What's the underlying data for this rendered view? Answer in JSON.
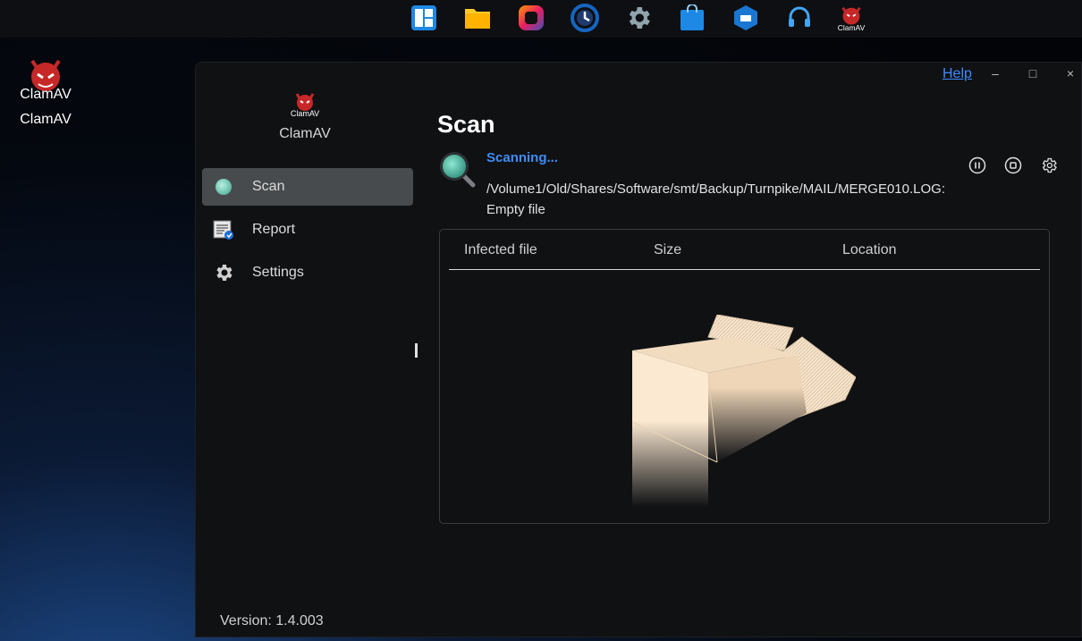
{
  "taskbar": {
    "apps": [
      {
        "icon": "control-panel-icon",
        "color": "#1e88e5"
      },
      {
        "icon": "file-station-icon",
        "color": "#ffca28"
      },
      {
        "icon": "photo-app-icon",
        "color": "#e91e63"
      },
      {
        "icon": "backup-clock-icon",
        "color": "#1565c0"
      },
      {
        "icon": "gear-icon",
        "color": "#90a4ae"
      },
      {
        "icon": "app-center-bag-icon",
        "color": "#1e88e5"
      },
      {
        "icon": "container-station-icon",
        "color": "#1976d2"
      },
      {
        "icon": "helpdesk-headset-icon",
        "color": "#42a5f5"
      },
      {
        "icon": "clamav-taskbar-icon",
        "color": "#c62828",
        "label": "ClamAV"
      }
    ]
  },
  "desktop": {
    "icon_label": "ClamAV",
    "icon_text": "ClamAV"
  },
  "window": {
    "help_label": "Help",
    "minimize_glyph": "–",
    "maximize_glyph": "□",
    "close_glyph": "×",
    "sidebar": {
      "app_name": "ClamAV",
      "logo_text": "ClamAV",
      "items": [
        {
          "label": "Scan",
          "icon": "scan-dot-icon",
          "active": true
        },
        {
          "label": "Report",
          "icon": "report-icon",
          "active": false
        },
        {
          "label": "Settings",
          "icon": "gear-icon",
          "active": false
        }
      ],
      "version": "Version: 1.4.003"
    },
    "main": {
      "title": "Scan",
      "status": "Scanning...",
      "current_path": "/Volume1/Old/Shares/Software/smt/Backup/Turnpike/MAIL/MERGE010.LOG: Empty file",
      "controls": [
        "pause-icon",
        "stop-icon",
        "scan-settings-icon"
      ],
      "table": {
        "columns": [
          "Infected file",
          "Size",
          "Location"
        ],
        "rows": []
      }
    }
  },
  "colors": {
    "accent": "#3e8ef7",
    "active_nav": "#484b4d",
    "window_bg": "#101113"
  }
}
